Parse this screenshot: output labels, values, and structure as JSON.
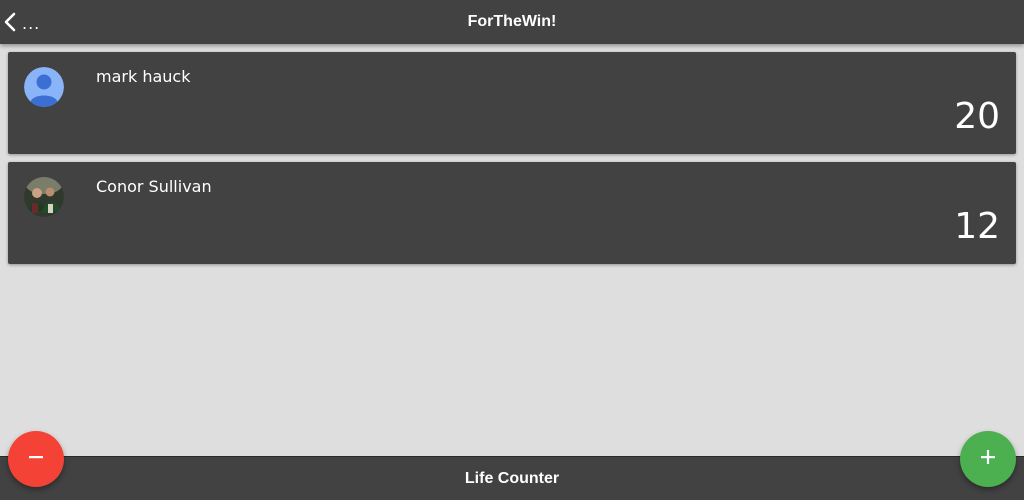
{
  "header": {
    "back_icon": "chevron-left-icon",
    "back_label": "...",
    "title": "ForTheWin!"
  },
  "players": [
    {
      "name": "mark hauck",
      "score": "20",
      "avatar": "default-person-avatar"
    },
    {
      "name": "Conor Sullivan",
      "score": "12",
      "avatar": "photo-avatar"
    }
  ],
  "footer": {
    "title": "Life Counter"
  },
  "actions": {
    "decrement_icon": "minus-icon",
    "increment_icon": "plus-icon"
  },
  "colors": {
    "bar": "#424242",
    "background": "#dedede",
    "decrement": "#f44336",
    "increment": "#4caf50"
  }
}
